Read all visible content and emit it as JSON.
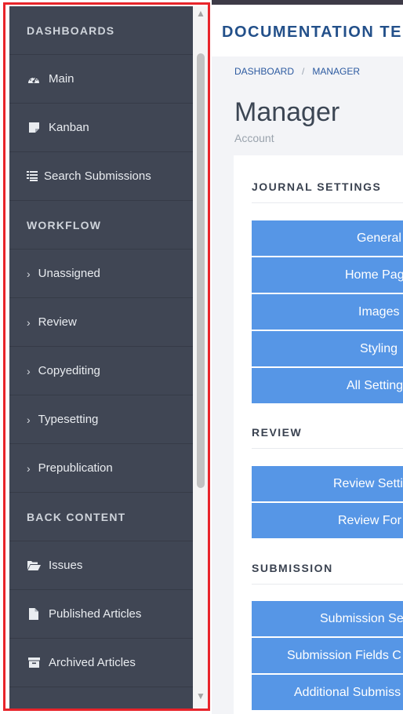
{
  "sidebar": {
    "items": [
      {
        "type": "header",
        "label": "DASHBOARDS"
      },
      {
        "type": "item",
        "icon": "dashboard-icon",
        "label": "Main"
      },
      {
        "type": "item",
        "icon": "note-icon",
        "label": "Kanban"
      },
      {
        "type": "item",
        "icon": "list-icon",
        "label": "Search Submissions"
      },
      {
        "type": "header",
        "label": "WORKFLOW"
      },
      {
        "type": "chevron",
        "label": "Unassigned"
      },
      {
        "type": "chevron",
        "label": "Review"
      },
      {
        "type": "chevron",
        "label": "Copyediting"
      },
      {
        "type": "chevron",
        "label": "Typesetting"
      },
      {
        "type": "chevron",
        "label": "Prepublication"
      },
      {
        "type": "header",
        "label": "BACK CONTENT"
      },
      {
        "type": "item",
        "icon": "folder-open-icon",
        "label": "Issues"
      },
      {
        "type": "item",
        "icon": "file-icon",
        "label": "Published Articles"
      },
      {
        "type": "item",
        "icon": "archive-icon",
        "label": "Archived Articles"
      }
    ]
  },
  "header": {
    "app_title": "DOCUMENTATION TE"
  },
  "breadcrumb": {
    "items": [
      "DASHBOARD",
      "MANAGER"
    ],
    "separator": "/"
  },
  "page": {
    "title": "Manager",
    "subtitle": "Account"
  },
  "sections": {
    "journal_settings": {
      "heading": "JOURNAL SETTINGS",
      "buttons": [
        "General",
        "Home Pag",
        "Images",
        "Styling",
        "All Setting"
      ]
    },
    "review": {
      "heading": "REVIEW",
      "buttons": [
        "Review Setti",
        "Review For"
      ]
    },
    "submission": {
      "heading": "SUBMISSION",
      "buttons": [
        "Submission Se",
        "Submission Fields C",
        "Additional Submiss"
      ]
    }
  },
  "colors": {
    "sidebar_bg": "#404654",
    "button_bg": "#5696e6",
    "title_color": "#23508a",
    "highlight": "#e8242a"
  }
}
